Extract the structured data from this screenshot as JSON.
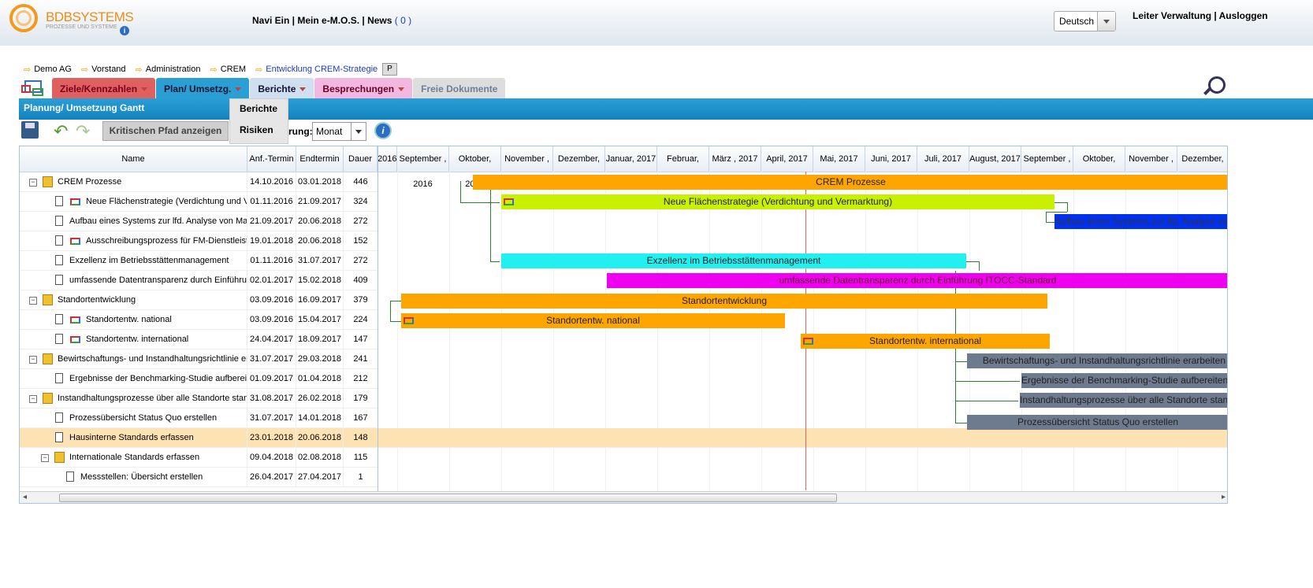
{
  "logo": {
    "name": "BDBSYSTEMS",
    "sub": "PROZESSE UND SYSTEME"
  },
  "topnav": {
    "text": "Navi Ein | Mein e-M.O.S. | News ",
    "news_count": "( 0 )"
  },
  "language": {
    "selected": "Deutsch"
  },
  "user": {
    "text": "Leiter Verwaltung | Ausloggen"
  },
  "breadcrumb": [
    "Demo AG",
    "Vorstand",
    "Administration",
    "CREM",
    "Entwicklung CREM-Strategie"
  ],
  "breadcrumb_badge": "P",
  "menu": {
    "ziele": "Ziele/Kennzahlen",
    "plan": "Plan/ Umsetzg.",
    "berichte": "Berichte",
    "besprechungen": "Besprechungen",
    "freie": "Freie Dokumente"
  },
  "dropdown": [
    "Berichte",
    "Risiken"
  ],
  "panel_title": "Planung/ Umsetzung Gantt",
  "toolbar": {
    "critical_path": "Kritischen Pfad anzeigen",
    "zoom_label": "rung:",
    "zoom_value": "Monat"
  },
  "columns": {
    "name": "Name",
    "start": "Anf.-Termin",
    "end": "Endtermin",
    "dur": "Dauer"
  },
  "months": [
    "2016",
    "September , 2016",
    "Oktober, 2016",
    "November , 2016",
    "Dezember, 2016",
    "Januar, 2017",
    "Februar, 2017",
    "März , 2017",
    "April, 2017",
    "Mai, 2017",
    "Juni, 2017",
    "Juli, 2017",
    "August, 2017",
    "September , 2017",
    "Oktober, 2017",
    "November , 2017",
    "Dezember, 2017"
  ],
  "rows": [
    {
      "name": "CREM Prozesse",
      "start": "14.10.2016",
      "end": "03.01.2018",
      "dur": "446"
    },
    {
      "name": "Neue Flächenstrategie (Verdichtung und Vermarktung)",
      "start": "01.11.2016",
      "end": "21.09.2017",
      "dur": "324"
    },
    {
      "name": "Aufbau eines Systems zur lfd. Analyse von Markt- und Objektdaten",
      "start": "21.09.2017",
      "end": "20.06.2018",
      "dur": "272"
    },
    {
      "name": "Ausschreibungsprozess für FM-Dienstleister",
      "start": "19.01.2018",
      "end": "20.06.2018",
      "dur": "152"
    },
    {
      "name": "Exzellenz im Betriebsstättenmanagement",
      "start": "01.11.2016",
      "end": "31.07.2017",
      "dur": "272"
    },
    {
      "name": "umfassende Datentransparenz durch Einführung ITOCC-Standard",
      "start": "02.01.2017",
      "end": "15.02.2018",
      "dur": "409"
    },
    {
      "name": "Standortentwicklung",
      "start": "03.09.2016",
      "end": "16.09.2017",
      "dur": "379"
    },
    {
      "name": "Standortentw. national",
      "start": "03.09.2016",
      "end": "15.04.2017",
      "dur": "224"
    },
    {
      "name": "Standortentw. international",
      "start": "24.04.2017",
      "end": "18.09.2017",
      "dur": "147"
    },
    {
      "name": "Bewirtschaftungs- und Instandhaltungsrichtlinie erarbeiten",
      "start": "31.07.2017",
      "end": "29.03.2018",
      "dur": "241"
    },
    {
      "name": "Ergebnisse der Benchmarking-Studie aufbereiten",
      "start": "01.09.2017",
      "end": "01.04.2018",
      "dur": "212"
    },
    {
      "name": "Instandhaltungsprozesse über alle Standorte standardisieren",
      "start": "31.08.2017",
      "end": "26.02.2018",
      "dur": "179"
    },
    {
      "name": "Prozessübersicht Status Quo erstellen",
      "start": "31.07.2017",
      "end": "14.01.2018",
      "dur": "167"
    },
    {
      "name": "Hausinterne Standards erfassen",
      "start": "23.01.2018",
      "end": "20.06.2018",
      "dur": "148"
    },
    {
      "name": "Internationale Standards erfassen",
      "start": "09.04.2018",
      "end": "02.08.2018",
      "dur": "115"
    },
    {
      "name": "Messstellen: Übersicht erstellen",
      "start": "26.04.2017",
      "end": "27.04.2017",
      "dur": "1"
    }
  ],
  "bars": [
    {
      "label": "CREM Prozesse",
      "color": "#ffa500"
    },
    {
      "label": "Neue Flächenstrategie (Verdichtung und Vermarktung)",
      "color": "#c8f000"
    },
    {
      "label": "Aufbau eines Systems zur lfd. Analyse von Markt- und Objektdaten",
      "color": "#0030f0"
    },
    {
      "label": "Exzellenz im Betriebsstättenmanagement",
      "color": "#20f0f0"
    },
    {
      "label": "umfassende Datentransparenz durch Einführung ITOCC-Standard",
      "color": "#f000f0"
    },
    {
      "label": "Standortentwicklung",
      "color": "#ffa500"
    },
    {
      "label": "Standortentw. national",
      "color": "#ffa500"
    },
    {
      "label": "Standortentw. international",
      "color": "#ffa500"
    },
    {
      "label": "Bewirtschaftungs- und Instandhaltungsrichtlinie erarbeiten",
      "color": "#6e7b8f"
    },
    {
      "label": "Ergebnisse der Benchmarking-Studie aufbereiten",
      "color": "#6e7b8f"
    },
    {
      "label": "Instandhaltungsprozesse über alle Standorte standardisieren",
      "color": "#6e7b8f"
    },
    {
      "label": "Prozessübersicht Status Quo erstellen",
      "color": "#6e7b8f"
    }
  ]
}
